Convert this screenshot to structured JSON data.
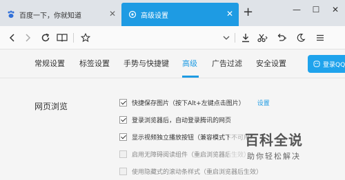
{
  "tabs": [
    {
      "title": "百度一下，你就知道",
      "active": false,
      "icon": "baidu-paw-icon"
    },
    {
      "title": "高级设置",
      "active": true,
      "icon": "gear-icon"
    }
  ],
  "new_tab_symbol": "+",
  "window_controls": {
    "minimize": "—",
    "maximize": "☐",
    "close": "✕"
  },
  "toolbar": {
    "back_icon": "chevron-left-icon",
    "forward_icon": "chevron-right-icon",
    "reload_icon": "reload-icon",
    "reader_icon": "book-icon",
    "favorite_icon": "star-icon",
    "right_icons": [
      "chevron-down-icon",
      "download-icon",
      "scissors-icon",
      "undo-icon",
      "moon-icon",
      "menu-icon"
    ]
  },
  "settings_nav": {
    "items": [
      "常规设置",
      "标签设置",
      "手势与快捷键",
      "高级",
      "广告过滤",
      "安全设置"
    ],
    "active_index": 3,
    "login_label": "登录QQ"
  },
  "section": {
    "title": "网页浏览",
    "options": [
      {
        "label": "快捷保存图片（按下Alt+左键点击图片）",
        "checked": true,
        "disabled": false,
        "link": "设置"
      },
      {
        "label": "登录浏览器后，自动登录腾讯的网页",
        "checked": true,
        "disabled": false
      },
      {
        "label": "显示视频独立播放按钮（兼容模式下不可用）",
        "checked": true,
        "disabled": false
      },
      {
        "label": "启用无障碍阅读组件（重启浏览器后生效）",
        "checked": false,
        "disabled": true
      },
      {
        "label": "使用隐藏式的滚动条样式（重启浏览器后生效）",
        "checked": false,
        "disabled": true
      }
    ]
  },
  "watermark": {
    "title": "百科全说",
    "subtitle": "助你轻松解决"
  },
  "colors": {
    "accent": "#1e9be3",
    "tab_bg": "#dfe3e8",
    "page_bg": "#f5f5f5"
  }
}
